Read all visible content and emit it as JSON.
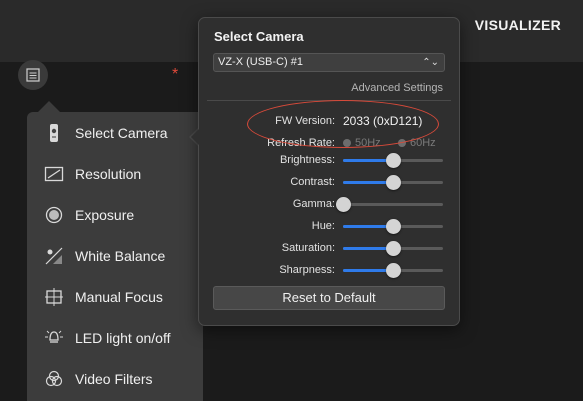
{
  "app": {
    "title": "VISUALIZER"
  },
  "sidebar": {
    "items": [
      {
        "label": "Select Camera",
        "icon": "camera-icon"
      },
      {
        "label": "Resolution",
        "icon": "resolution-icon"
      },
      {
        "label": "Exposure",
        "icon": "exposure-icon"
      },
      {
        "label": "White Balance",
        "icon": "white-balance-icon"
      },
      {
        "label": "Manual Focus",
        "icon": "focus-icon"
      },
      {
        "label": "LED light on/off",
        "icon": "led-icon"
      },
      {
        "label": "Video Filters",
        "icon": "filters-icon"
      }
    ]
  },
  "panel": {
    "title": "Select Camera",
    "camera_select": {
      "value": "VZ-X (USB-C) #1"
    },
    "advanced_label": "Advanced Settings",
    "fw": {
      "label": "FW Version:",
      "value": "2033 (0xD121)"
    },
    "refresh": {
      "label": "Refresh Rate:",
      "options": [
        "50Hz",
        "60Hz"
      ]
    },
    "sliders": [
      {
        "label": "Brightness:",
        "value": 0.5
      },
      {
        "label": "Contrast:",
        "value": 0.5
      },
      {
        "label": "Gamma:",
        "value": 0.0
      },
      {
        "label": "Hue:",
        "value": 0.5
      },
      {
        "label": "Saturation:",
        "value": 0.5
      },
      {
        "label": "Sharpness:",
        "value": 0.5
      }
    ],
    "reset_label": "Reset to Default"
  },
  "colors": {
    "accent": "#2f7bea",
    "annotation": "#d84a3a"
  }
}
